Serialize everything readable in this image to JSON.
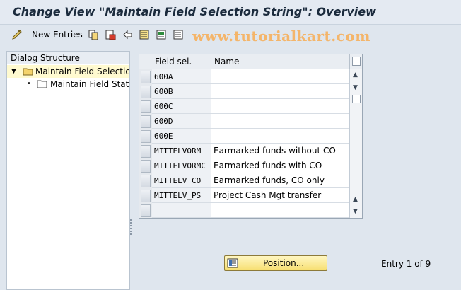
{
  "window": {
    "title": "Change View \"Maintain Field Selection String\": Overview"
  },
  "toolbar": {
    "new_entries_label": "New Entries",
    "icons": [
      "display-change-icon",
      "copy-icon",
      "delete-icon",
      "undo-icon",
      "select-all-icon",
      "select-block-icon",
      "deselect-all-icon"
    ]
  },
  "watermark": "www.tutorialkart.com",
  "dialog_structure": {
    "header": "Dialog Structure",
    "items": [
      {
        "label": "Maintain Field Selection S",
        "level": 0,
        "expanded": true,
        "selected": true
      },
      {
        "label": "Maintain Field Status",
        "level": 1,
        "selected": false
      }
    ]
  },
  "table": {
    "columns": [
      "Field sel.",
      "Name"
    ],
    "rows": [
      {
        "key": "600A",
        "name": ""
      },
      {
        "key": "600B",
        "name": ""
      },
      {
        "key": "600C",
        "name": ""
      },
      {
        "key": "600D",
        "name": ""
      },
      {
        "key": "600E",
        "name": ""
      },
      {
        "key": "MITTELVORM",
        "name": "Earmarked funds without CO"
      },
      {
        "key": "MITTELVORMC",
        "name": "Earmarked funds with CO"
      },
      {
        "key": "MITTELV_CO",
        "name": "Earmarked funds, CO only"
      },
      {
        "key": "MITTELV_PS",
        "name": "Project Cash Mgt transfer"
      },
      {
        "key": "",
        "name": ""
      }
    ]
  },
  "position_button": {
    "label": "Position..."
  },
  "entry_info": "Entry 1 of 9",
  "colors": {
    "accent_button": "#f7df72",
    "selected_tree": "#fffad0",
    "watermark": "#f4b56a"
  }
}
